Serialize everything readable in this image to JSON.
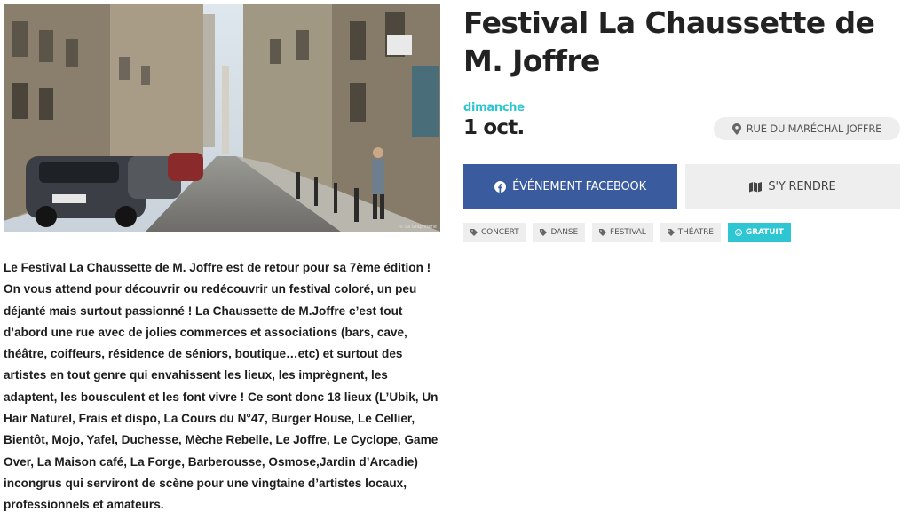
{
  "event": {
    "title": "Festival La Chaussette de M. Joffre",
    "day_label": "dimanche",
    "date": "1 oct.",
    "location": "RUE DU MARÉCHAL JOFFRE",
    "photo_credit": "© La Graphiterie",
    "description": "Le Festival La Chaussette de M. Joffre est de retour pour sa 7ème édition ! On vous attend pour découvrir ou redécouvrir un festival coloré, un peu déjanté mais surtout passionné ! La Chaussette de M.Joffre c’est tout d’abord une rue avec de jolies commerces et associations (bars, cave, théâtre, coiffeurs, résidence de séniors, boutique…etc) et surtout des artistes en tout genre qui envahissent les lieux, les imprègnent, les adaptent, les bousculent et les font vivre ! Ce sont donc 18 lieux (L’Ubik, Un Hair Naturel, Frais et dispo, La Cours du N°47, Burger House, Le Cellier, Bientôt, Mojo, Yafel, Duchesse, Mèche Rebelle, Le Joffre, Le Cyclope, Game Over, La Maison café, La Forge, Barberousse, Osmose,Jardin d’Arcadie) incongrus qui serviront de scène pour une vingtaine d’artistes locaux, professionnels et amateurs."
  },
  "buttons": {
    "facebook_label": "ÉVÉNEMENT FACEBOOK",
    "route_label": "S'Y RENDRE"
  },
  "tags": [
    {
      "label": "CONCERT"
    },
    {
      "label": "DANSE"
    },
    {
      "label": "FESTIVAL"
    },
    {
      "label": "THÉATRE"
    },
    {
      "label": "GRATUIT"
    }
  ],
  "colors": {
    "accent": "#2fc6d3",
    "facebook": "#3b5b9f",
    "pill_bg": "#eeeeee"
  },
  "icons": {
    "location": "map-pin-icon",
    "facebook": "facebook-icon",
    "route": "map-icon",
    "tag": "tag-icon",
    "free": "smile-icon"
  }
}
